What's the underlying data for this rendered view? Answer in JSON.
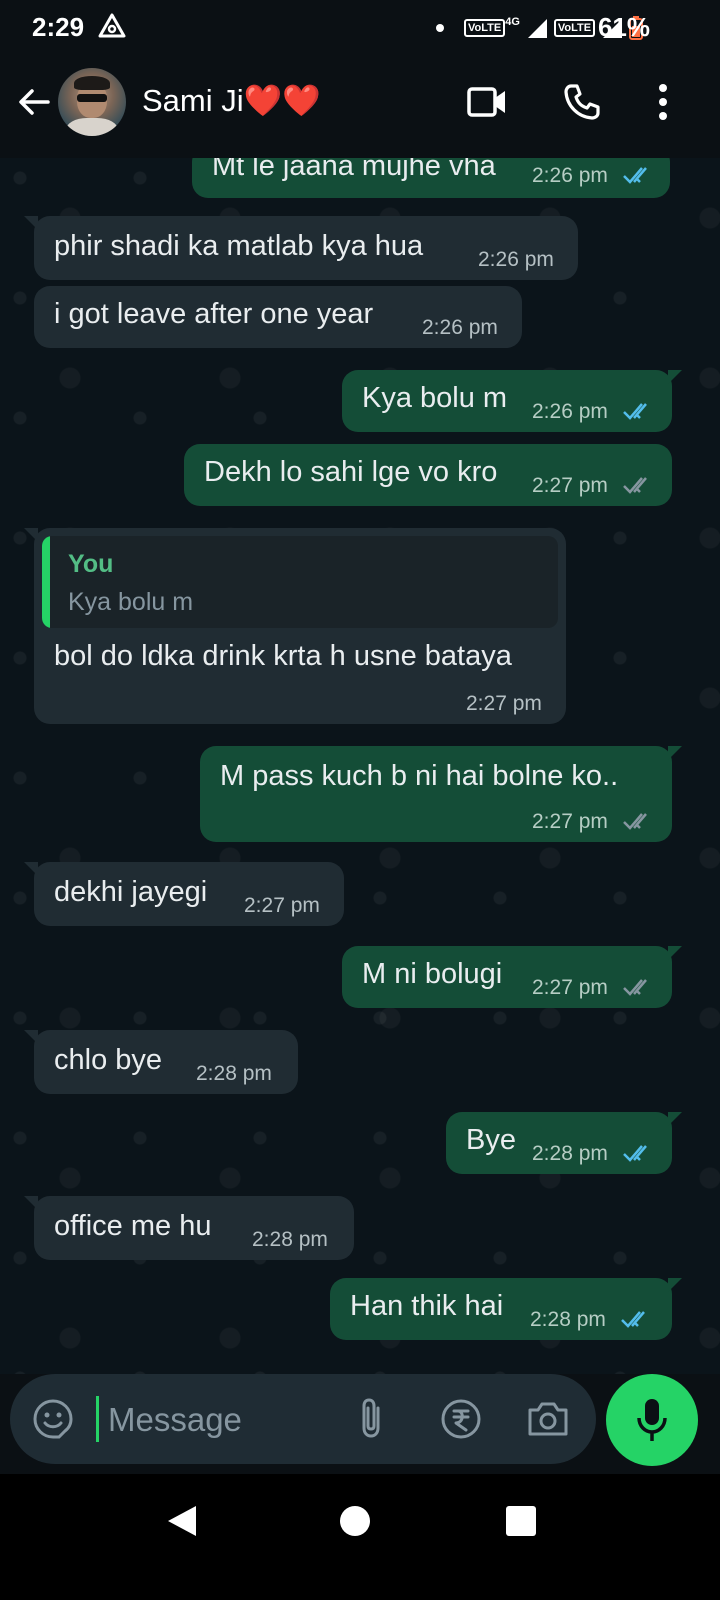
{
  "status_bar": {
    "time": "2:29",
    "network_label_1": "VoLTE",
    "network_type": "4G",
    "network_label_2": "VoLTE",
    "battery": "61%"
  },
  "header": {
    "contact_name": "Sami Ji❤️❤️"
  },
  "messages": [
    {
      "dir": "out",
      "text": "Mt le jaana mujhe vha",
      "time": "2:26 pm",
      "status": "read"
    },
    {
      "dir": "in",
      "text": "phir shadi ka matlab kya hua",
      "time": "2:26 pm"
    },
    {
      "dir": "in",
      "text": "i got leave after one year",
      "time": "2:26 pm"
    },
    {
      "dir": "out",
      "text": "Kya bolu m",
      "time": "2:26 pm",
      "status": "read"
    },
    {
      "dir": "out",
      "text": "Dekh lo sahi lge vo kro",
      "time": "2:27 pm",
      "status": "delivered"
    },
    {
      "dir": "in",
      "quote_author": "You",
      "quote_text": "Kya bolu m",
      "text": "bol do ldka drink krta h usne bataya",
      "time": "2:27 pm"
    },
    {
      "dir": "out",
      "text": "M pass kuch b ni hai bolne ko..",
      "time": "2:27 pm",
      "status": "delivered"
    },
    {
      "dir": "in",
      "text": "dekhi jayegi",
      "time": "2:27 pm"
    },
    {
      "dir": "out",
      "text": "M ni bolugi",
      "time": "2:27 pm",
      "status": "delivered"
    },
    {
      "dir": "in",
      "text": "chlo bye",
      "time": "2:28 pm"
    },
    {
      "dir": "out",
      "text": "Bye",
      "time": "2:28 pm",
      "status": "read"
    },
    {
      "dir": "in",
      "text": "office me hu",
      "time": "2:28 pm"
    },
    {
      "dir": "out",
      "text": "Han thik hai",
      "time": "2:28 pm",
      "status": "read"
    }
  ],
  "composer": {
    "placeholder": "Message"
  },
  "colors": {
    "accent": "#25d366",
    "read_tick": "#53bdeb",
    "delivered_tick": "#8696a0",
    "incoming_bubble": "#202c33",
    "outgoing_bubble": "#144d37"
  },
  "icons": [
    "back-arrow-icon",
    "video-call-icon",
    "phone-icon",
    "more-vert-icon",
    "sticker-icon",
    "attach-icon",
    "rupee-icon",
    "camera-icon",
    "mic-icon"
  ]
}
